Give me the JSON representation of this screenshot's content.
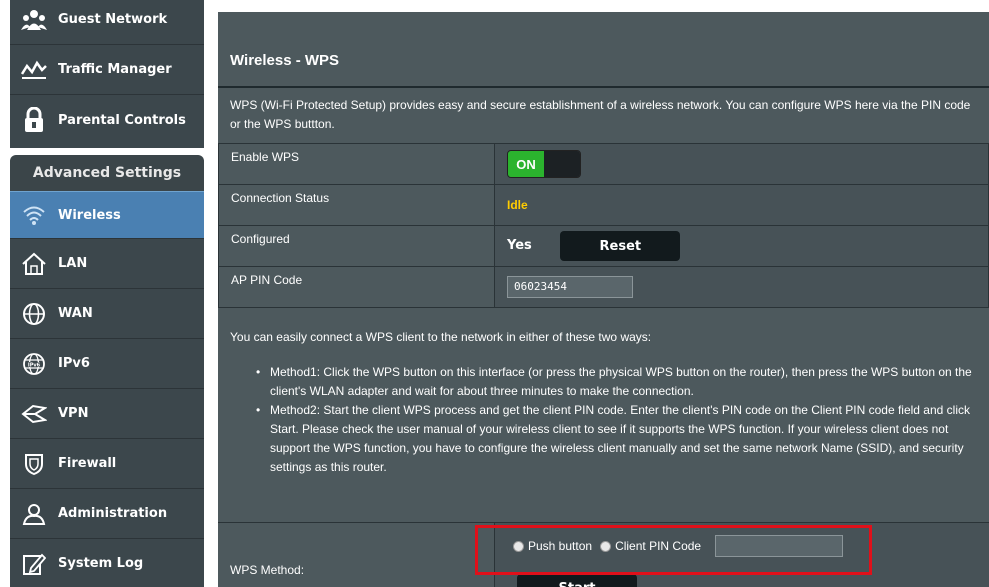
{
  "sidebar": {
    "items_top": [
      {
        "label": "Guest Network",
        "icon": "guest-network-icon"
      },
      {
        "label": "Traffic Manager",
        "icon": "traffic-manager-icon"
      },
      {
        "label": "Parental Controls",
        "icon": "lock-icon"
      }
    ],
    "advanced_header": "Advanced Settings",
    "items_advanced": [
      {
        "label": "Wireless",
        "icon": "wifi-icon",
        "active": true
      },
      {
        "label": "LAN",
        "icon": "home-icon"
      },
      {
        "label": "WAN",
        "icon": "globe-icon"
      },
      {
        "label": "IPv6",
        "icon": "ipv6-globe-icon"
      },
      {
        "label": "VPN",
        "icon": "vpn-icon"
      },
      {
        "label": "Firewall",
        "icon": "shield-icon"
      },
      {
        "label": "Administration",
        "icon": "person-icon"
      },
      {
        "label": "System Log",
        "icon": "edit-log-icon"
      }
    ]
  },
  "main": {
    "title": "Wireless - WPS",
    "description": "WPS (Wi-Fi Protected Setup) provides easy and secure establishment of a wireless network. You can configure WPS here via the PIN code or the WPS buttton.",
    "rows": {
      "enable_wps_label": "Enable WPS",
      "enable_wps_value": "ON",
      "connection_status_label": "Connection Status",
      "connection_status_value": "Idle",
      "configured_label": "Configured",
      "configured_value": "Yes",
      "reset_label": "Reset",
      "ap_pin_label": "AP PIN Code",
      "ap_pin_value": "06023454"
    },
    "ways_intro": "You can easily connect a WPS client to the network in either of these two ways:",
    "methods": [
      "Method1: Click the WPS button on this interface (or press the physical WPS button on the router), then press the WPS button on the client's WLAN adapter and wait for about three minutes to make the connection.",
      "Method2: Start the client WPS process and get the client PIN code. Enter the client's PIN code on the Client PIN code field and click Start. Please check the user manual of your wireless client to see if it supports the WPS function. If your wireless client does not support the WPS function, you have to configure the wireless client manually and set the same network Name (SSID), and security settings as this router."
    ],
    "wps_method": {
      "label": "WPS Method:",
      "option_push": "Push button",
      "option_pin": "Client PIN Code",
      "client_pin_value": "",
      "start_label": "Start"
    }
  },
  "colors": {
    "panel_bg": "#4d595d",
    "active_menu": "#4a80b2",
    "toggle_on": "#2bb32e",
    "status_idle": "#ffcc00",
    "highlight": "#e0101a"
  }
}
